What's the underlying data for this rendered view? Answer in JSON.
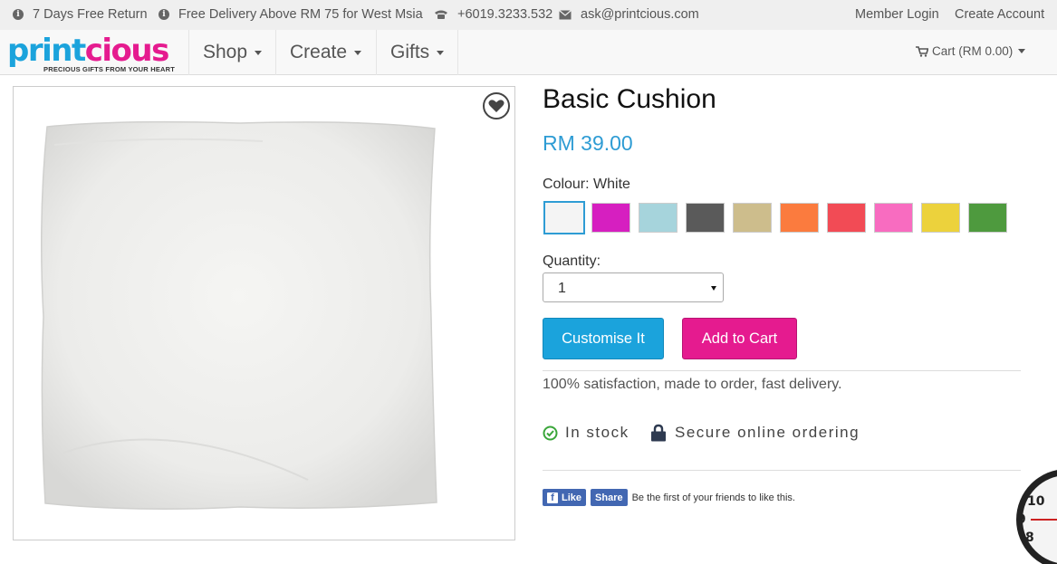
{
  "topbar": {
    "returns": "7 Days Free Return",
    "delivery": "Free Delivery Above RM 75 for West Msia",
    "phone": "+6019.3233.532",
    "email": "ask@printcious.com",
    "member_login": "Member Login",
    "create_account": "Create Account"
  },
  "nav": {
    "logo_text": "printcious",
    "logo_tagline": "PRECIOUS GIFTS FROM YOUR HEART",
    "menu": [
      "Shop",
      "Create",
      "Gifts"
    ],
    "cart": "Cart (RM 0.00)"
  },
  "product": {
    "title": "Basic Cushion",
    "price": "RM 39.00",
    "colour_label": "Colour: White",
    "swatches": [
      {
        "name": "white",
        "color": "#f4f4f4"
      },
      {
        "name": "magenta",
        "color": "#d61fc0"
      },
      {
        "name": "light-blue",
        "color": "#a6d4dc"
      },
      {
        "name": "dark-grey",
        "color": "#5a5a5a"
      },
      {
        "name": "khaki",
        "color": "#cdbd8c"
      },
      {
        "name": "orange",
        "color": "#fb7b3e"
      },
      {
        "name": "red",
        "color": "#f24b55"
      },
      {
        "name": "pink",
        "color": "#f86cc0"
      },
      {
        "name": "yellow",
        "color": "#ecd23c"
      },
      {
        "name": "green",
        "color": "#4e9a3e"
      }
    ],
    "quantity_label": "Quantity:",
    "quantity_value": "1",
    "customise_label": "Customise It",
    "add_to_cart_label": "Add to Cart",
    "satisfaction": "100% satisfaction, made to order, fast delivery.",
    "in_stock": "In stock",
    "secure": "Secure online ordering"
  },
  "facebook": {
    "like": "Like",
    "share": "Share",
    "text": "Be the first of your friends to like this."
  },
  "colors": {
    "accent_blue": "#2e9cd4",
    "accent_pink": "#e51b8f"
  }
}
